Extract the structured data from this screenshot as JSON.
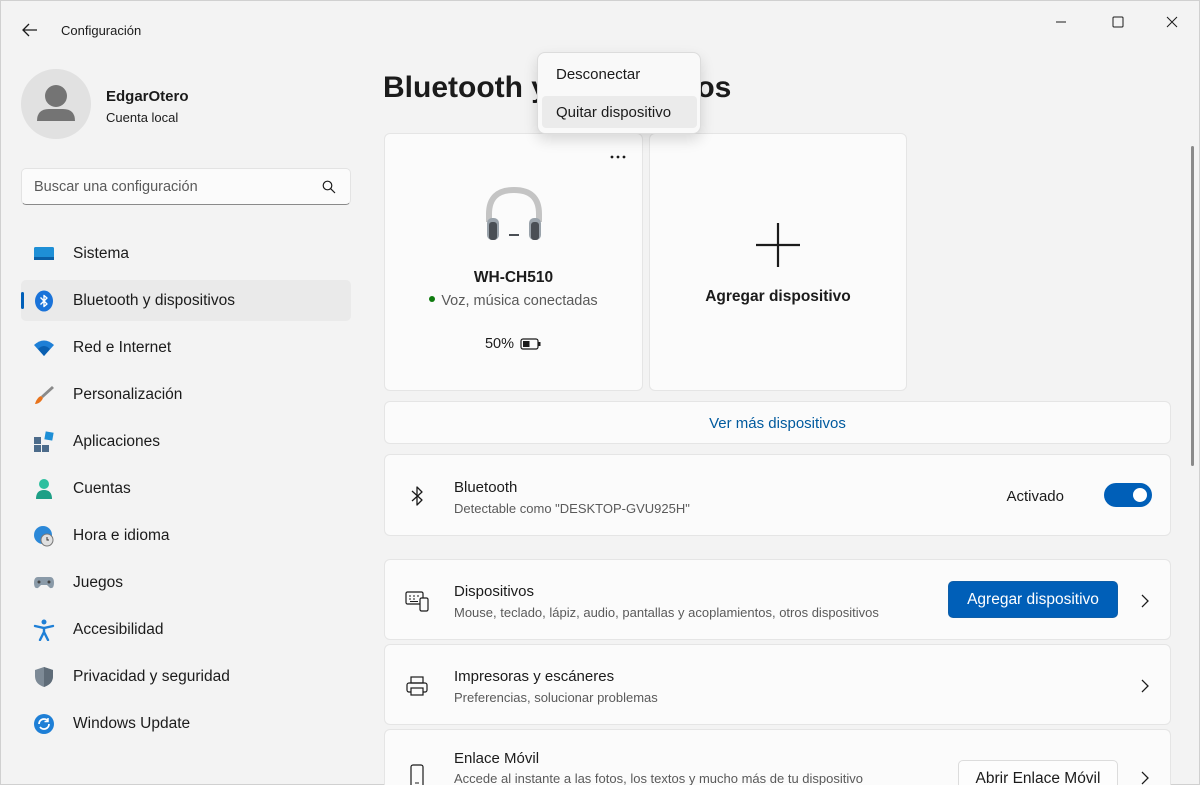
{
  "window": {
    "title": "Configuración",
    "controls": [
      "minimize",
      "maximize",
      "close"
    ]
  },
  "profile": {
    "name": "EdgarOtero",
    "account_type": "Cuenta local"
  },
  "search": {
    "placeholder": "Buscar una configuración",
    "value": ""
  },
  "sidebar": {
    "active": "Bluetooth y dispositivos",
    "items": [
      {
        "label": "Sistema",
        "icon": "system-icon"
      },
      {
        "label": "Bluetooth y dispositivos",
        "icon": "bluetooth-icon"
      },
      {
        "label": "Red e Internet",
        "icon": "wifi-icon"
      },
      {
        "label": "Personalización",
        "icon": "brush-icon"
      },
      {
        "label": "Aplicaciones",
        "icon": "apps-icon"
      },
      {
        "label": "Cuentas",
        "icon": "account-icon"
      },
      {
        "label": "Hora e idioma",
        "icon": "globe-clock-icon"
      },
      {
        "label": "Juegos",
        "icon": "gamepad-icon"
      },
      {
        "label": "Accesibilidad",
        "icon": "accessibility-icon"
      },
      {
        "label": "Privacidad y seguridad",
        "icon": "shield-icon"
      },
      {
        "label": "Windows Update",
        "icon": "update-icon"
      }
    ]
  },
  "main": {
    "title": "Bluetooth y dispositivos",
    "device_card": {
      "name": "WH-CH510",
      "status": "Voz, música conectadas",
      "battery": "50%",
      "battery_level": 0.5
    },
    "add_card": {
      "label": "Agregar dispositivo"
    },
    "see_more": "Ver más dispositivos",
    "bluetooth_row": {
      "title": "Bluetooth",
      "subtitle": "Detectable como \"DESKTOP-GVU925H\"",
      "toggle_label": "Activado",
      "toggle_on": true
    },
    "devices_row": {
      "title": "Dispositivos",
      "subtitle": "Mouse, teclado, lápiz, audio, pantallas y acoplamientos, otros dispositivos",
      "button": "Agregar dispositivo"
    },
    "printers_row": {
      "title": "Impresoras y escáneres",
      "subtitle": "Preferencias, solucionar problemas"
    },
    "phone_link_row": {
      "title": "Enlace Móvil",
      "subtitle": "Accede al instante a las fotos, los textos y mucho más de tu dispositivo",
      "button": "Abrir Enlace Móvil"
    }
  },
  "context_menu": {
    "items": [
      "Desconectar",
      "Quitar dispositivo"
    ],
    "hovered": "Quitar dispositivo"
  },
  "colors": {
    "accent": "#005fb8",
    "link": "#005a9e",
    "connected": "#0f7b0f",
    "background": "#f3f3f3",
    "card": "#fbfbfb"
  }
}
